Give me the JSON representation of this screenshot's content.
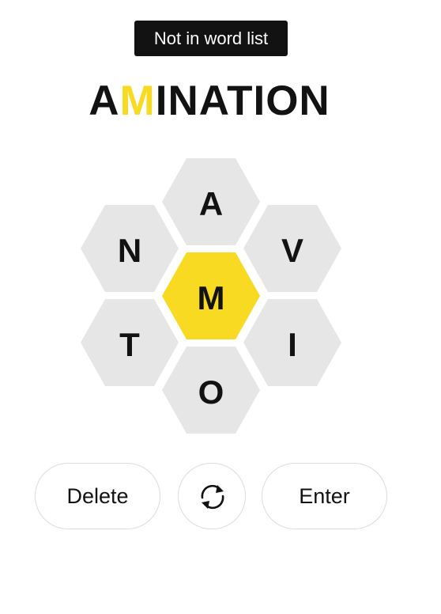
{
  "toast": {
    "message": "Not in word list"
  },
  "input": {
    "letters": [
      "A",
      "M",
      "I",
      "N",
      "A",
      "T",
      "I",
      "O",
      "N"
    ],
    "center_letter_index": 1
  },
  "hive": {
    "center": {
      "letter": "M",
      "color": "#f7da21"
    },
    "outer": [
      {
        "position": "top",
        "letter": "A"
      },
      {
        "position": "upper-left",
        "letter": "N"
      },
      {
        "position": "upper-right",
        "letter": "V"
      },
      {
        "position": "lower-left",
        "letter": "T"
      },
      {
        "position": "lower-right",
        "letter": "I"
      },
      {
        "position": "bottom",
        "letter": "O"
      }
    ],
    "outer_color": "#e6e6e6"
  },
  "controls": {
    "delete_label": "Delete",
    "shuffle_icon": "shuffle-icon",
    "enter_label": "Enter"
  }
}
